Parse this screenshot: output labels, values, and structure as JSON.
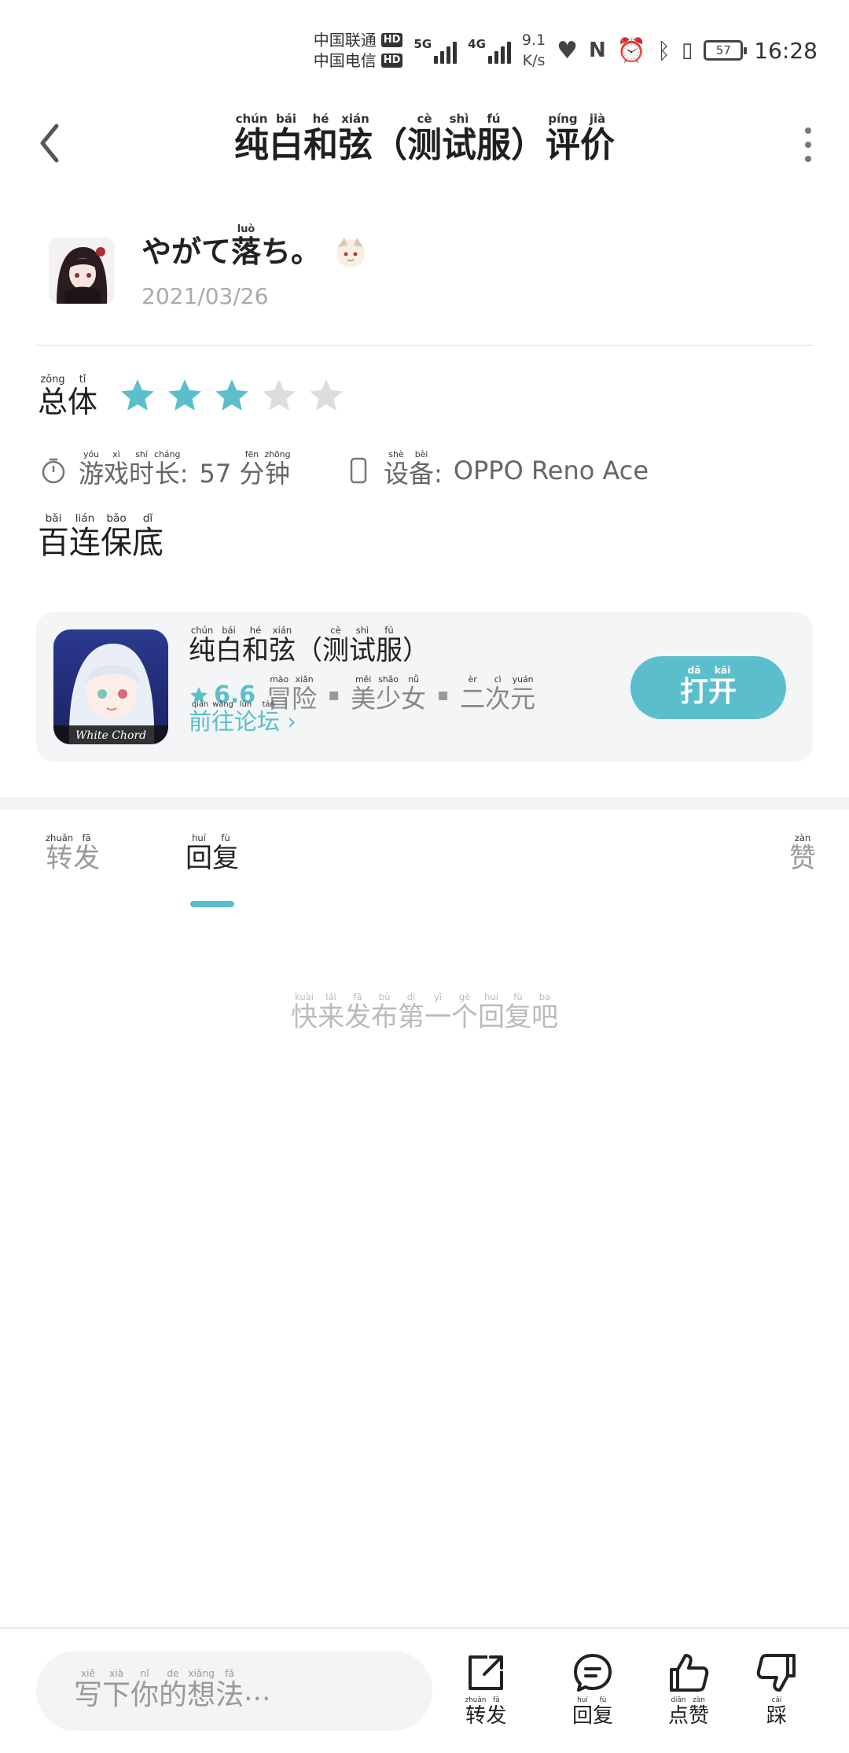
{
  "status": {
    "carrier1": "中国联通",
    "carrier2": "中国电信",
    "hd": "HD",
    "net1": "5G",
    "net2": "4G",
    "speed_value": "9.1",
    "speed_unit": "K/s",
    "battery": "57",
    "time": "16:28"
  },
  "header": {
    "title": "纯白和弦（测试服）评价"
  },
  "review": {
    "username": "やがて落ち。",
    "date": "2021/03/26",
    "rating_label": "总体",
    "rating": 3,
    "rating_max": 5,
    "playtime_label": "游戏时长:",
    "playtime_value": "57 分钟",
    "device_label": "设备:",
    "device_value": "OPPO Reno Ace",
    "text": "百连保底"
  },
  "game": {
    "name": "纯白和弦（测试服）",
    "icon_caption": "White Chord",
    "score": "6.6",
    "tags": [
      "冒险",
      "美少女",
      "二次元"
    ],
    "forum_link": "前往论坛",
    "open_button": "打开"
  },
  "tabs": {
    "forward": "转发",
    "reply": "回复",
    "like": "赞"
  },
  "empty_text": "快来发布第一个回复吧",
  "bottom": {
    "placeholder": "写下你的想法...",
    "forward": "转发",
    "reply": "回复",
    "like": "点赞",
    "dislike": "踩"
  },
  "colors": {
    "accent": "#5bbfcb",
    "star_empty": "#dddddd"
  }
}
